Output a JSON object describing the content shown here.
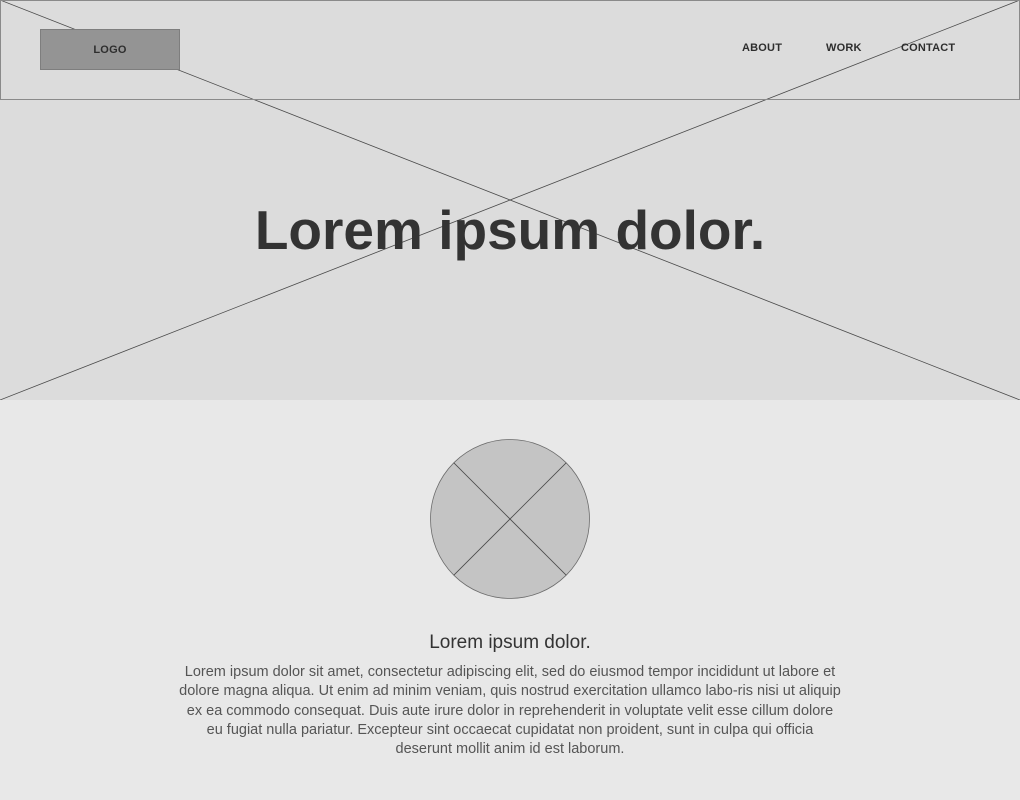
{
  "header": {
    "logo_text": "LOGO",
    "nav": {
      "about": "ABOUT",
      "work": "WORK",
      "contact": "CONTACT"
    }
  },
  "hero": {
    "title": "Lorem ipsum dolor."
  },
  "feature": {
    "title": "Lorem ipsum dolor.",
    "body": "Lorem ipsum dolor sit amet, consectetur adipiscing elit, sed do eiusmod tempor incididunt ut labore et dolore magna aliqua. Ut enim ad minim veniam, quis nostrud exercitation ullamco labo-ris nisi ut aliquip ex ea commodo consequat. Duis aute irure dolor in reprehenderit in voluptate velit esse cillum dolore eu fugiat nulla pariatur. Excepteur sint occaecat cupidatat non proident, sunt in culpa qui officia deserunt mollit anim id est laborum."
  },
  "colors": {
    "page_background": "#e8e8e8",
    "hero_background": "#dcdcdc",
    "logo_placeholder": "#949494",
    "circle_placeholder": "#c4c4c4",
    "text_dark": "#333333",
    "text_body": "#555555",
    "wireframe_line": "#4a4a4a"
  },
  "icons": {
    "hero_image": "image-placeholder-cross",
    "feature_image": "image-placeholder-circle"
  }
}
